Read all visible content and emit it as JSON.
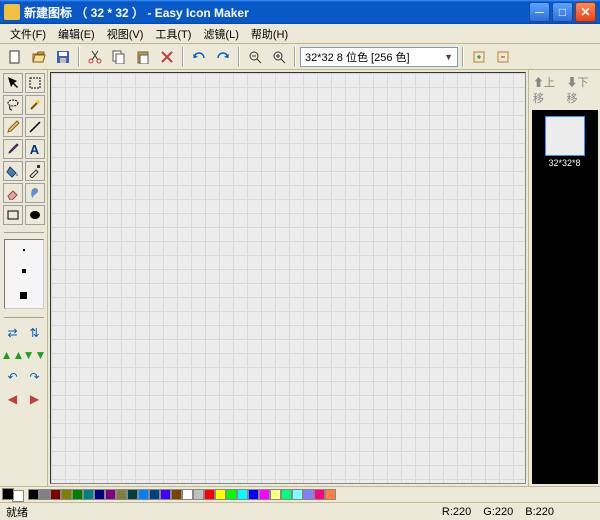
{
  "title": "新建图标 （ 32 * 32 ）  - Easy Icon Maker",
  "menus": {
    "file": "文件(F)",
    "edit": "编辑(E)",
    "view": "视图(V)",
    "tools": "工具(T)",
    "filter": "滤镜(L)",
    "help": "帮助(H)"
  },
  "toolbar": {
    "size_label": "32*32  8 位色 [256 色]"
  },
  "side": {
    "up": "上移",
    "down": "下移"
  },
  "preview": {
    "label": "32*32*8"
  },
  "status": {
    "ready": "就绪",
    "r": "R:220",
    "g": "G:220",
    "b": "B:220"
  },
  "palette": [
    "#000000",
    "#808080",
    "#800000",
    "#808000",
    "#008000",
    "#008080",
    "#000080",
    "#800080",
    "#7e8040",
    "#004040",
    "#0080ff",
    "#003f80",
    "#4000ff",
    "#804000",
    "#ffffff",
    "#c0c0c0",
    "#ff0000",
    "#ffff00",
    "#00ff00",
    "#00ffff",
    "#0000ff",
    "#ff00ff",
    "#ffff80",
    "#00ff80",
    "#80ffff",
    "#8080ff",
    "#ff0080",
    "#ff8040"
  ],
  "icons": {
    "new": "new-icon",
    "open": "open-icon",
    "save": "save-icon",
    "cut": "cut-icon",
    "copy": "copy-icon",
    "paste": "paste-icon",
    "undo": "undo-icon",
    "redo": "redo-icon",
    "zoomout": "zoom-out-icon",
    "zoomin": "zoom-in-icon",
    "addframe": "add-frame-icon",
    "delframe": "del-frame-icon",
    "arrow": "pointer-icon",
    "select": "selection-icon",
    "lasso": "lasso-icon",
    "wand": "wand-icon",
    "pencil": "pencil-icon",
    "line": "line-icon",
    "brush": "brush-icon",
    "text": "text-icon",
    "fill": "fill-icon",
    "picker": "eyedropper-icon",
    "eraser": "eraser-icon",
    "smudge": "smudge-icon",
    "rect": "rectangle-icon",
    "ellipse": "ellipse-icon"
  }
}
